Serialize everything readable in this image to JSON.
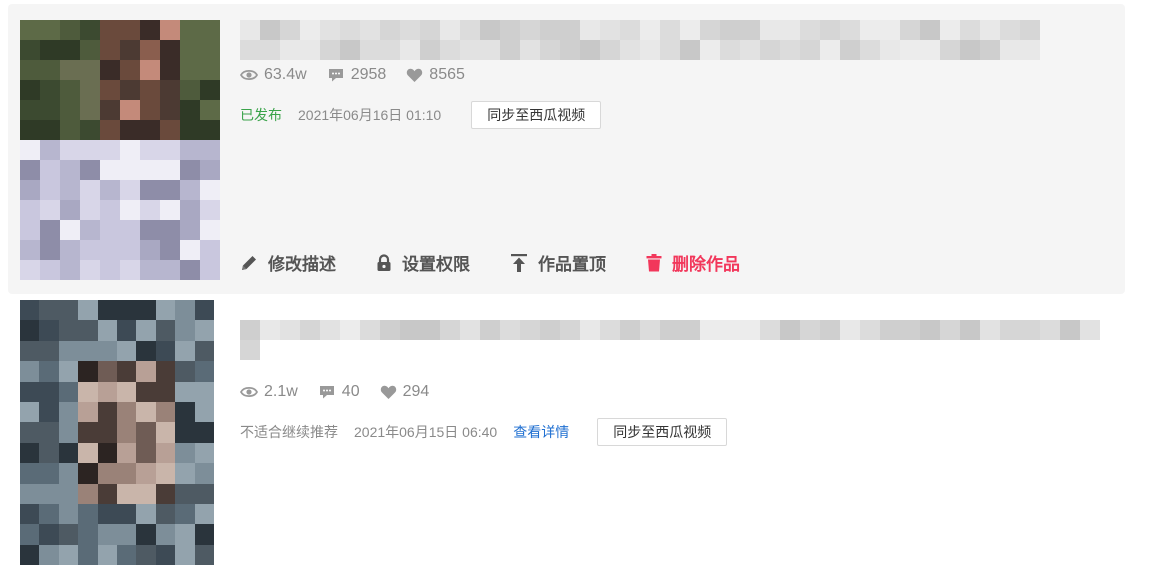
{
  "videos": [
    {
      "stats": {
        "views": "63.4w",
        "comments": "2958",
        "likes": "8565"
      },
      "status": "已发布",
      "publish_time": "2021年06月16日 01:10",
      "sync_button_label": "同步至西瓜视频",
      "actions": {
        "edit_label": "修改描述",
        "permission_label": "设置权限",
        "pin_label": "作品置顶",
        "delete_label": "删除作品"
      }
    },
    {
      "stats": {
        "views": "2.1w",
        "comments": "40",
        "likes": "294"
      },
      "status": "不适合继续推荐",
      "publish_time": "2021年06月15日 06:40",
      "detail_link_label": "查看详情",
      "sync_button_label": "同步至西瓜视频"
    }
  ],
  "colors": {
    "published_green": "#3aa34a",
    "delete_red": "#f2375b",
    "link_blue": "#1f6fd1",
    "icon_gray": "#999999",
    "card_background": "#f5f5f5"
  },
  "icons": {
    "views": "eye-icon",
    "comments": "comment-icon",
    "likes": "heart-icon",
    "edit": "pencil-icon",
    "permission": "lock-icon",
    "pin": "pin-top-icon",
    "delete": "trash-icon"
  }
}
